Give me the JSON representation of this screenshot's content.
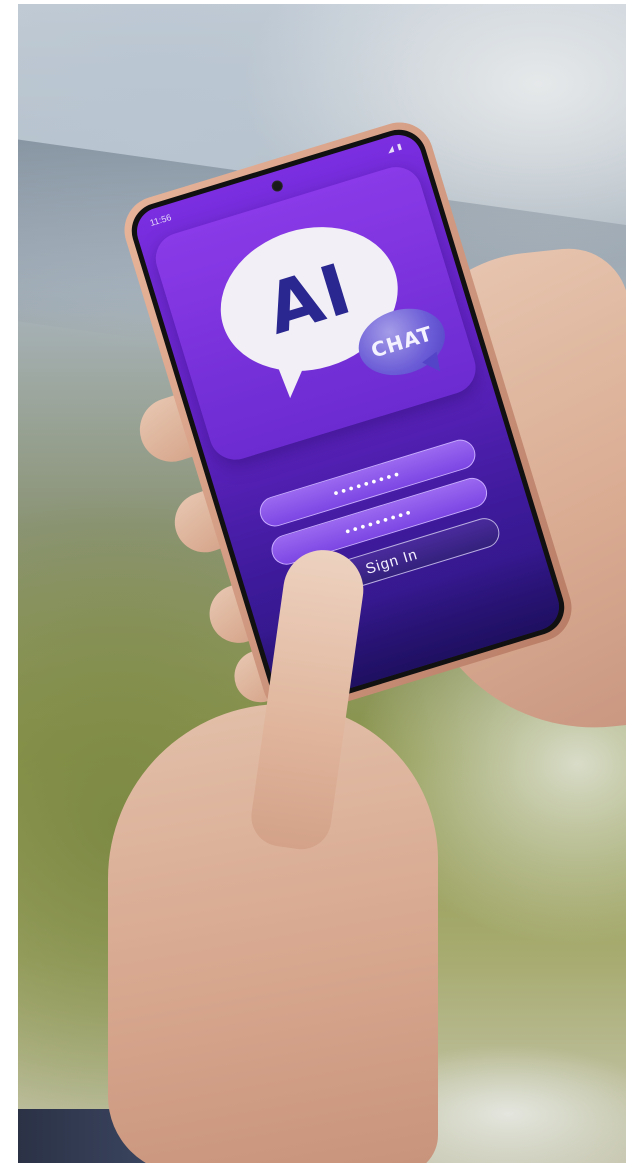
{
  "status_bar": {
    "time": "11:56",
    "icons": "◢ ▮"
  },
  "logo": {
    "main_text": "AI",
    "secondary_text": "CHAT"
  },
  "login_form": {
    "username_field_value": "•••••••••",
    "password_field_value": "•••••••••",
    "sign_in_label": "Sign In"
  },
  "colors": {
    "screen_top": "#7a2ee0",
    "screen_bottom": "#2c1680",
    "field_fill": "#8a55ea",
    "logo_text": "#2a2790"
  }
}
